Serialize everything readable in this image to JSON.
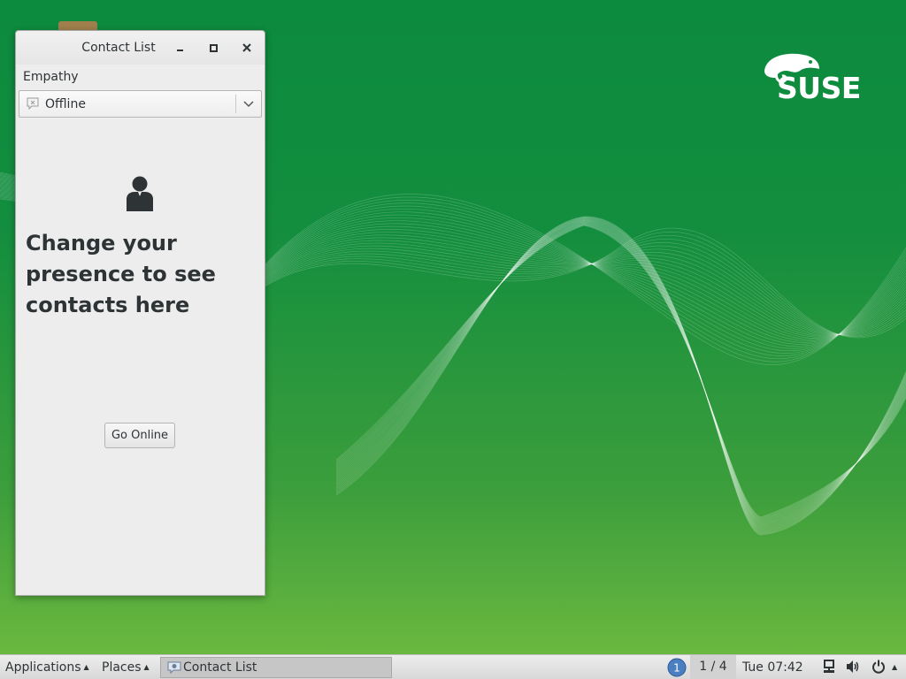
{
  "window": {
    "title": "Contact List",
    "app_menu_label": "Empathy",
    "presence": {
      "selected": "Offline"
    },
    "empty_message": "Change your presence to see contacts here",
    "go_online_label": "Go Online"
  },
  "desktop": {
    "brand_text": "SUSE",
    "background_color": "#138e3e"
  },
  "taskbar": {
    "applications_label": "Applications",
    "places_label": "Places",
    "window_button_label": "Contact List",
    "workspace_number": "1",
    "workspace_pager": "1 / 4",
    "clock": "Tue 07:42",
    "icons": [
      "network-icon",
      "volume-icon",
      "power-icon"
    ]
  }
}
